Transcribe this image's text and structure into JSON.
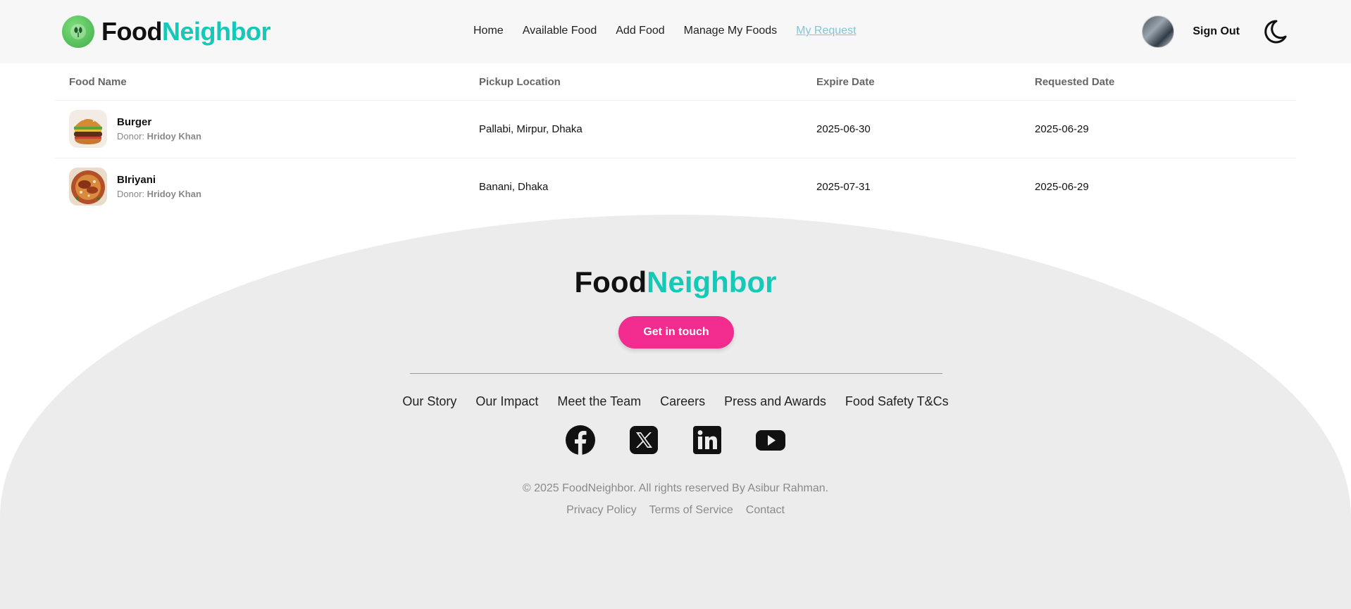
{
  "navbar": {
    "brand_part1": "Food",
    "brand_part2": "Neighbor",
    "links": [
      "Home",
      "Available Food",
      "Add Food",
      "Manage My Foods",
      "My Request"
    ],
    "active_link": "My Request",
    "sign_out": "Sign Out",
    "theme_icon": "moon-icon"
  },
  "table": {
    "headers": [
      "Food Name",
      "Pickup Location",
      "Expire Date",
      "Requested Date"
    ],
    "rows": [
      {
        "food_name": "Burger",
        "donor_label": "Donor: ",
        "donor_name": "Hridoy Khan",
        "location": "Pallabi, Mirpur, Dhaka",
        "expire_date": "2025-06-30",
        "requested_date": "2025-06-29"
      },
      {
        "food_name": "BIriyani",
        "donor_label": "Donor: ",
        "donor_name": "Hridoy Khan",
        "location": "Banani, Dhaka",
        "expire_date": "2025-07-31",
        "requested_date": "2025-06-29"
      }
    ]
  },
  "footer": {
    "brand_part1": "Food",
    "brand_part2": "Neighbor",
    "cta": "Get in touch",
    "links": [
      "Our Story",
      "Our Impact",
      "Meet the Team",
      "Careers",
      "Press and Awards",
      "Food Safety T&Cs"
    ],
    "social_icons": [
      "facebook-icon",
      "x-icon",
      "linkedin-icon",
      "youtube-icon"
    ],
    "copyright": "© 2025 FoodNeighbor. All rights reserved By Asibur Rahman.",
    "legal_links": [
      "Privacy Policy",
      "Terms of Service",
      "Contact"
    ]
  },
  "colors": {
    "brand_teal": "#14c9b8",
    "cta_pink": "#f22b8f",
    "active_link": "#7fc7d7",
    "footer_bg": "#ececec"
  }
}
